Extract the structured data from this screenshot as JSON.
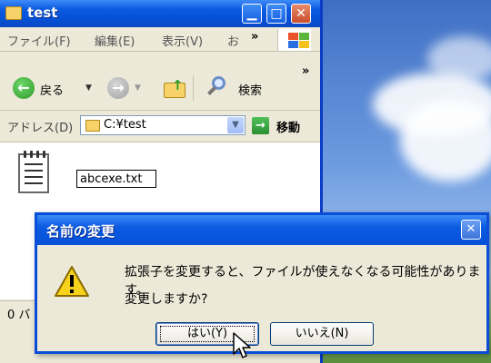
{
  "explorer": {
    "title": "test",
    "title_buttons": {
      "minimize": "▁",
      "maximize": "□",
      "close": "✕"
    },
    "menu": [
      "ファイル(F)",
      "編集(E)",
      "表示(V)",
      "お"
    ],
    "menu_overflow": "»",
    "toolbar": {
      "back_label": "戻る",
      "search_label": "検索",
      "overflow": "»"
    },
    "address": {
      "label": "アドレス(D)",
      "value": "C:¥test",
      "go_label": "移動"
    },
    "file": {
      "rename_value": "abcexe.txt"
    },
    "status": "0 バ"
  },
  "dialog": {
    "title": "名前の変更",
    "message_line1": "拡張子を変更すると、ファイルが使えなくなる可能性があります。",
    "message_line2": "変更しますか?",
    "yes_button": "はい(Y)",
    "no_button": "いいえ(N)",
    "close": "✕"
  },
  "colors": {
    "titlebar_blue": "#0a5ae0",
    "desktop_sky": "#6d9be0",
    "warning_yellow": "#f7d21c"
  }
}
